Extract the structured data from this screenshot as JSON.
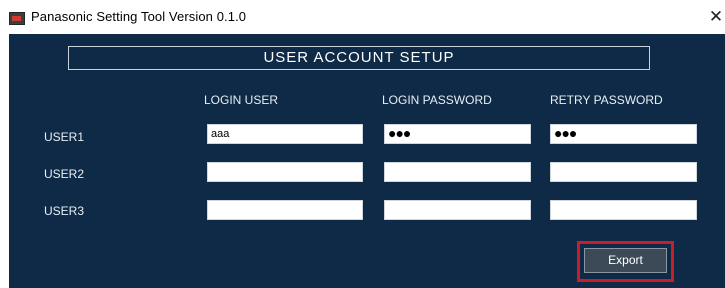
{
  "window": {
    "title": "Panasonic Setting Tool  Version 0.1.0",
    "close_glyph": "✕"
  },
  "section": {
    "title": "USER ACCOUNT SETUP"
  },
  "columns": [
    "LOGIN USER",
    "LOGIN PASSWORD",
    "RETRY PASSWORD"
  ],
  "rows": [
    {
      "label": "USER1",
      "login_user": "aaa",
      "login_password": "●●●",
      "retry_password": "●●●"
    },
    {
      "label": "USER2",
      "login_user": "",
      "login_password": "",
      "retry_password": ""
    },
    {
      "label": "USER3",
      "login_user": "",
      "login_password": "",
      "retry_password": ""
    }
  ],
  "actions": {
    "export_label": "Export"
  },
  "colors": {
    "panel_background": "#0e2a47",
    "highlight_border": "#c81e2b"
  }
}
